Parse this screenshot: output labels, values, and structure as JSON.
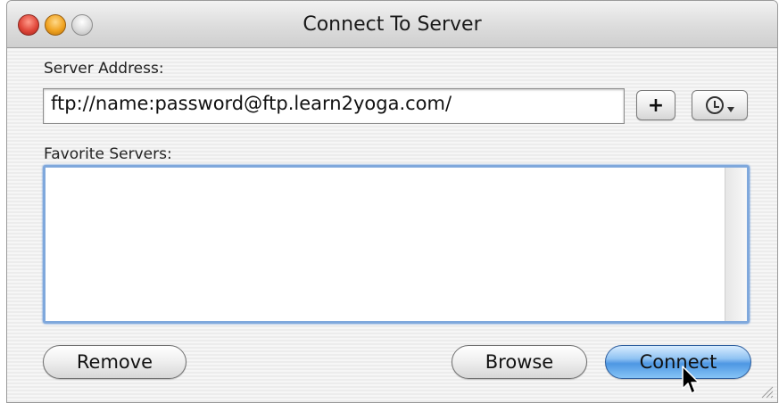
{
  "window": {
    "title": "Connect To Server"
  },
  "server_address": {
    "label": "Server Address:",
    "value": "ftp://name:password@ftp.learn2yoga.com/"
  },
  "toolbar": {
    "add_label": "+",
    "recent_icon": "clock-icon"
  },
  "favorites": {
    "label": "Favorite Servers:",
    "items": []
  },
  "buttons": {
    "remove": "Remove",
    "browse": "Browse",
    "connect": "Connect"
  },
  "colors": {
    "focus_ring": "#7fa8dc",
    "default_button": "#4e97e3",
    "close": "#e0473a",
    "minimize": "#f0a321"
  }
}
